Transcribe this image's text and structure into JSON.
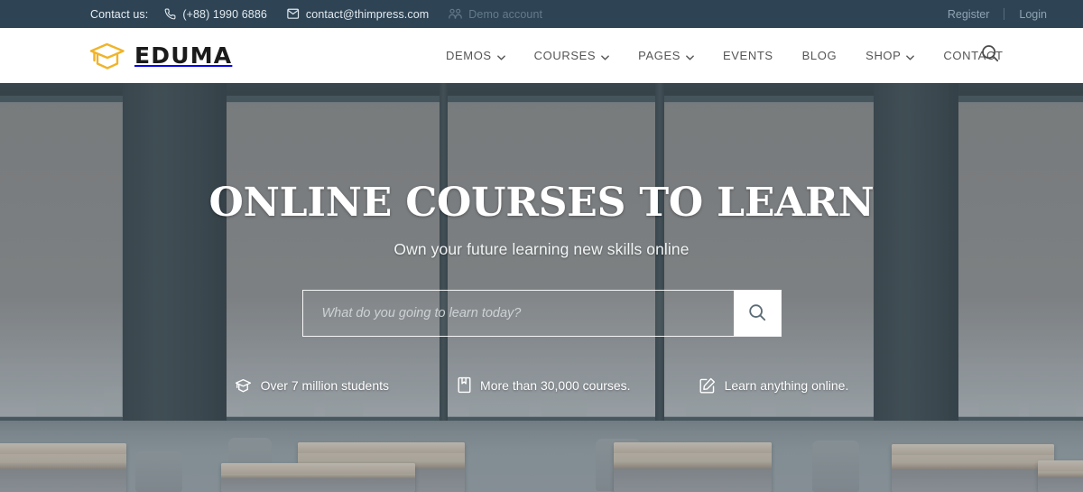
{
  "topbar": {
    "contact_label": "Contact us:",
    "phone": "(+88) 1990 6886",
    "email": "contact@thimpress.com",
    "demo_account": "Demo account",
    "register": "Register",
    "login": "Login",
    "background_color": "#2e4455"
  },
  "header": {
    "logo_text": "EDUMA",
    "logo_color": "#f0b429",
    "nav": [
      {
        "label": "DEMOS",
        "has_dropdown": true
      },
      {
        "label": "COURSES",
        "has_dropdown": true
      },
      {
        "label": "PAGES",
        "has_dropdown": true
      },
      {
        "label": "EVENTS",
        "has_dropdown": false
      },
      {
        "label": "BLOG",
        "has_dropdown": false
      },
      {
        "label": "SHOP",
        "has_dropdown": true
      },
      {
        "label": "CONTACT",
        "has_dropdown": false
      }
    ]
  },
  "hero": {
    "title": "ONLINE COURSES TO LEARN",
    "subtitle": "Own your future learning new skills online",
    "search": {
      "placeholder": "What do you going to learn today?",
      "value": ""
    },
    "stats": [
      {
        "icon": "graduation-cap-icon",
        "text": "Over 7 million students"
      },
      {
        "icon": "book-icon",
        "text": "More than 30,000 courses."
      },
      {
        "icon": "pencil-square-icon",
        "text": "Learn anything online."
      }
    ]
  }
}
